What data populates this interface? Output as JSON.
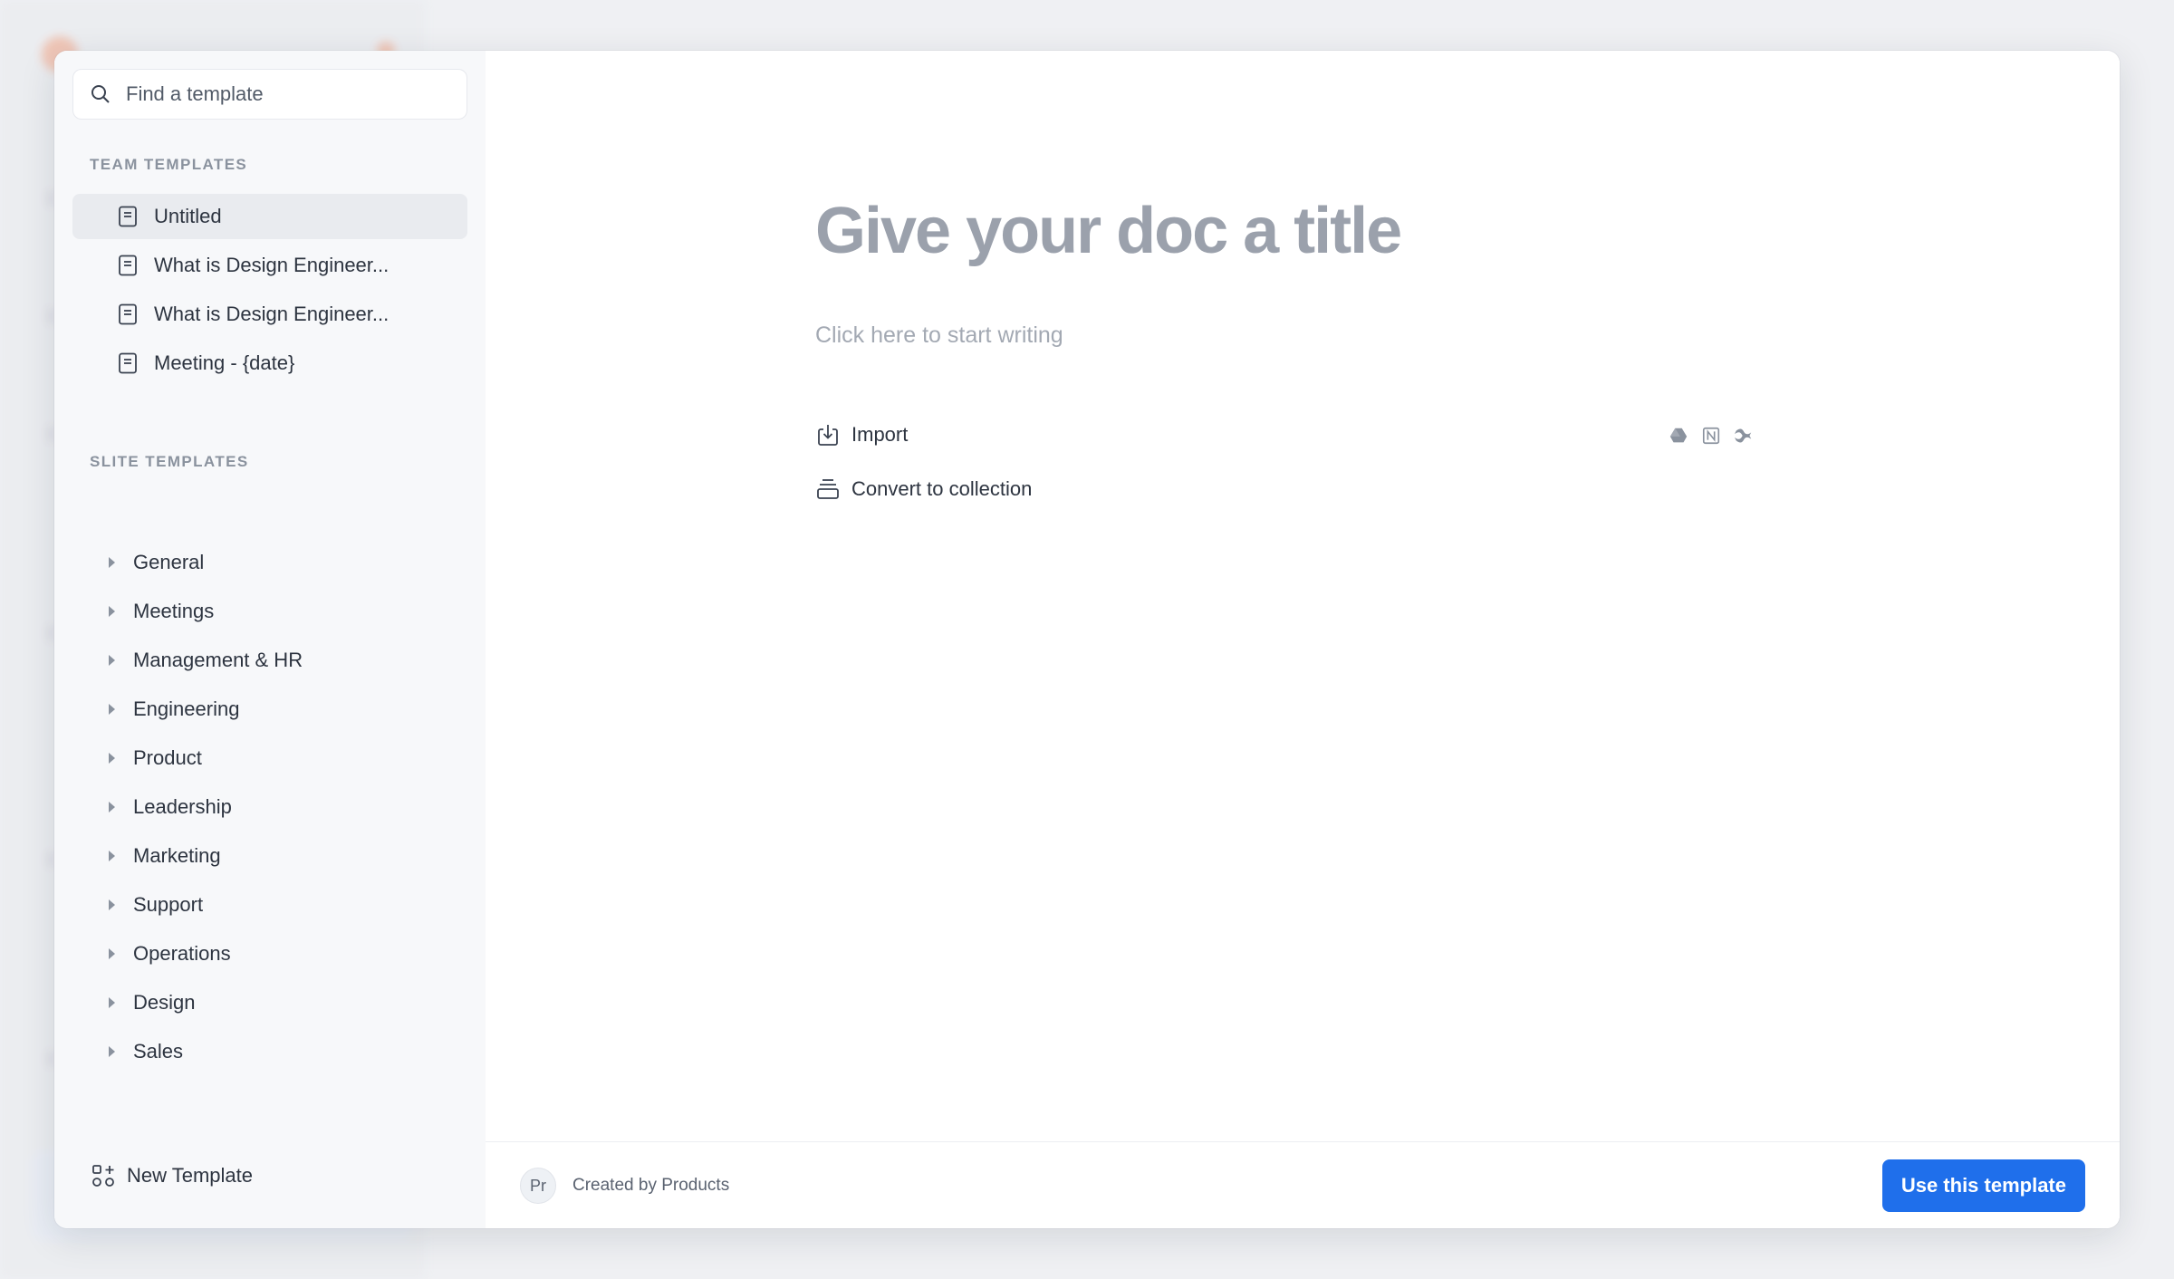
{
  "search": {
    "placeholder": "Find a template"
  },
  "team_templates": {
    "label": "TEAM TEMPLATES",
    "items": [
      {
        "label": "Untitled",
        "selected": true
      },
      {
        "label": "What is Design Engineer..."
      },
      {
        "label": "What is Design Engineer..."
      },
      {
        "label": "Meeting - {date}"
      }
    ]
  },
  "slite_templates": {
    "label": "SLITE TEMPLATES",
    "items": [
      {
        "label": "General"
      },
      {
        "label": "Meetings"
      },
      {
        "label": "Management & HR"
      },
      {
        "label": "Engineering"
      },
      {
        "label": "Product"
      },
      {
        "label": "Leadership"
      },
      {
        "label": "Marketing"
      },
      {
        "label": "Support"
      },
      {
        "label": "Operations"
      },
      {
        "label": "Design"
      },
      {
        "label": "Sales"
      }
    ]
  },
  "new_template_label": "New Template",
  "doc": {
    "title_placeholder": "Give your doc a title",
    "body_placeholder": "Click here to start writing",
    "import_label": "Import",
    "convert_label": "Convert to collection",
    "import_sources": [
      "google-drive-icon",
      "notion-icon",
      "confluence-icon"
    ]
  },
  "footer": {
    "avatar_initials": "Pr",
    "created_by": "Created by Products",
    "use_button": "Use this template"
  },
  "colors": {
    "primary": "#1f6feb",
    "sidebar_bg": "#f7f8fa",
    "selected_bg": "#e9ebef"
  }
}
